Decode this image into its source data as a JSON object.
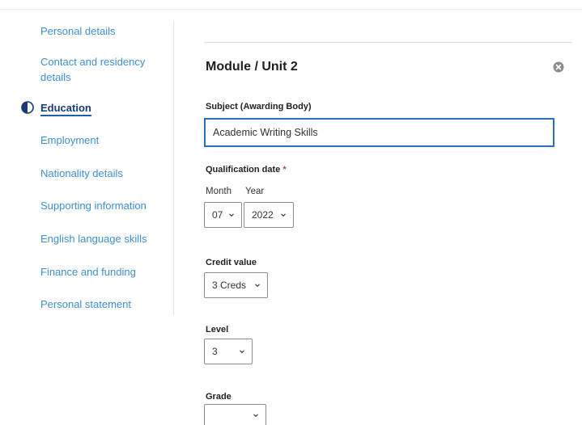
{
  "sidebar": {
    "items": [
      {
        "label": "Personal details",
        "active": false
      },
      {
        "label": "Contact and residency details",
        "active": false
      },
      {
        "label": "Education",
        "active": true
      },
      {
        "label": "Employment",
        "active": false
      },
      {
        "label": "Nationality details",
        "active": false
      },
      {
        "label": "Supporting information",
        "active": false
      },
      {
        "label": "English language skills",
        "active": false
      },
      {
        "label": "Finance and funding",
        "active": false
      },
      {
        "label": "Personal statement",
        "active": false
      }
    ]
  },
  "section": {
    "title": "Module / Unit 2"
  },
  "form": {
    "subject": {
      "label": "Subject (Awarding Body)",
      "value": "Academic Writing Skills"
    },
    "qualification_date": {
      "label": "Qualification date",
      "required_marker": "*",
      "month_label": "Month",
      "year_label": "Year",
      "month_value": "07",
      "year_value": "2022"
    },
    "credit_value": {
      "label": "Credit value",
      "value": "3 Creds"
    },
    "level": {
      "label": "Level",
      "value": "3"
    },
    "grade": {
      "label": "Grade",
      "value": ""
    }
  },
  "colors": {
    "accent": "#2a6fb8",
    "link": "#3d8fd1",
    "active_nav": "#173b78",
    "required": "#d9373f"
  },
  "icons": {
    "active_nav": "half-circle-icon",
    "close": "close-circle-icon",
    "dropdown": "chevron-down-icon"
  }
}
